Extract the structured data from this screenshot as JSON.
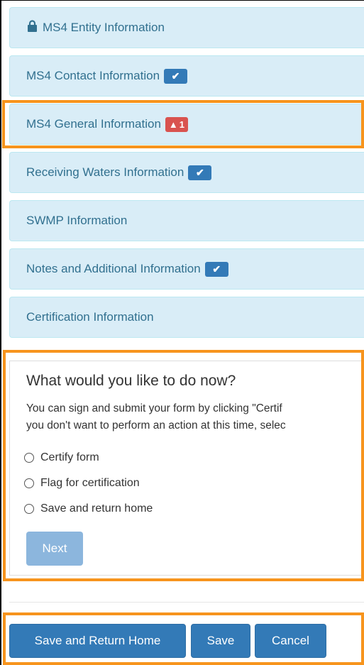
{
  "sections": {
    "entity": "MS4 Entity Information",
    "contact": "MS4 Contact Information",
    "general": "MS4 General Information",
    "general_warning_count": "1",
    "receiving": "Receiving Waters Information",
    "swmp": "SWMP Information",
    "notes": "Notes and Additional Information",
    "certification": "Certification Information"
  },
  "action_panel": {
    "title": "What would you like to do now?",
    "text_line1": "You can sign and submit your form by clicking \"Certif",
    "text_line2": "you don't want to perform an action at this time, selec",
    "options": [
      "Certify form",
      "Flag for certification",
      "Save and return home"
    ],
    "next_label": "Next"
  },
  "footer": {
    "save_return_label": "Save and Return Home",
    "save_label": "Save",
    "cancel_label": "Cancel"
  },
  "colors": {
    "accent_orange": "#f7941d",
    "section_bg": "#d9edf7",
    "primary_blue": "#337ab7",
    "danger_red": "#d9534f"
  }
}
